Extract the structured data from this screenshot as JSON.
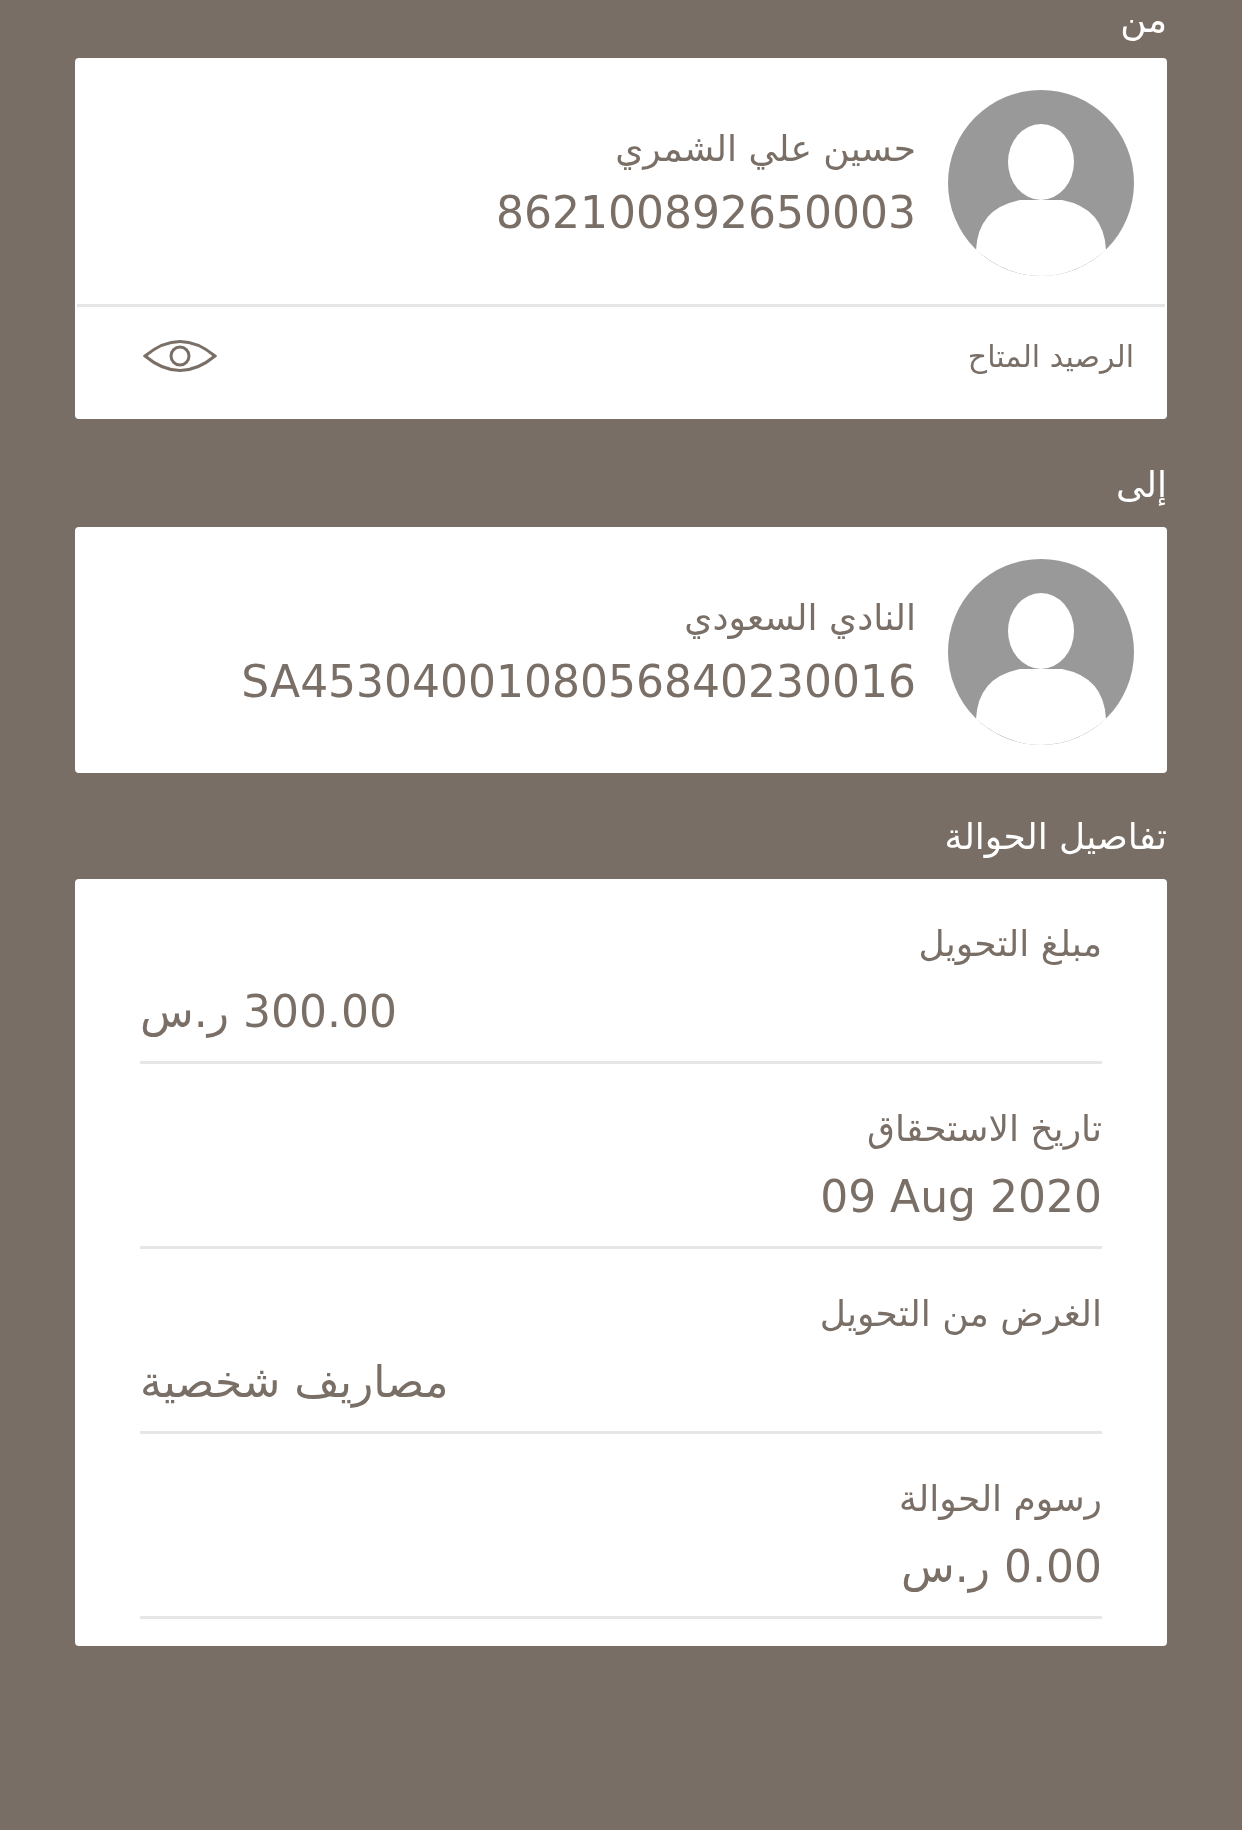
{
  "from": {
    "heading": "من",
    "name": "حسين علي الشمري",
    "account": "862100892650003",
    "balance_label": "الرصيد المتاح"
  },
  "to": {
    "heading": "إلى",
    "name": "النادي السعودي",
    "account": "SA4530400108056840230016"
  },
  "details": {
    "heading": "تفاصيل الحوالة",
    "rows": [
      {
        "kind": "field",
        "label": "مبلغ التحويل",
        "value": "300.00 ر.س"
      },
      {
        "kind": "text",
        "label": "تاريخ الاستحقاق",
        "value": "09 Aug 2020"
      },
      {
        "kind": "field",
        "label": "الغرض من التحويل",
        "value": "مصاريف شخصية"
      },
      {
        "kind": "text",
        "label": "رسوم الحوالة",
        "value": "0.00 ر.س"
      }
    ]
  }
}
